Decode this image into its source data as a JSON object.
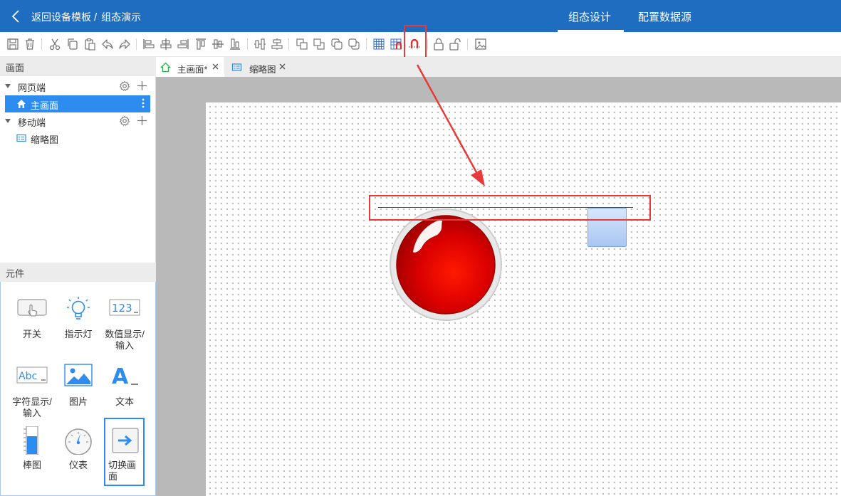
{
  "header": {
    "back_label": "返回设备模板",
    "separator": "/",
    "project_name": "组态演示",
    "tabs": [
      {
        "label": "组态设计",
        "active": true
      },
      {
        "label": "配置数据源",
        "active": false
      }
    ]
  },
  "toolbar": {
    "buttons": [
      {
        "name": "save-icon"
      },
      {
        "name": "delete-icon"
      },
      {
        "name": "cut-icon"
      },
      {
        "name": "copy-icon"
      },
      {
        "name": "paste-icon"
      },
      {
        "name": "undo-icon"
      },
      {
        "name": "redo-icon"
      },
      {
        "name": "align-left-icon"
      },
      {
        "name": "align-center-h-icon"
      },
      {
        "name": "align-right-icon"
      },
      {
        "name": "align-top-icon"
      },
      {
        "name": "align-middle-v-icon"
      },
      {
        "name": "align-bottom-icon"
      },
      {
        "name": "distribute-h-icon"
      },
      {
        "name": "distribute-v-icon"
      },
      {
        "name": "bring-front-icon"
      },
      {
        "name": "send-back-icon"
      },
      {
        "name": "bring-forward-icon"
      },
      {
        "name": "send-backward-icon"
      },
      {
        "name": "grid-icon"
      },
      {
        "name": "snap-grid-icon"
      },
      {
        "name": "snap-guide-icon"
      },
      {
        "name": "lock-icon"
      },
      {
        "name": "unlock-icon"
      },
      {
        "name": "image-icon"
      }
    ]
  },
  "left_panel": {
    "screens_title": "画面",
    "tree": {
      "web": {
        "label": "网页端",
        "pages": [
          {
            "label": "主画面",
            "selected": true
          }
        ]
      },
      "mobile": {
        "label": "移动端",
        "pages": [
          {
            "label": "缩略图",
            "selected": false
          }
        ]
      }
    },
    "components_title": "元件",
    "components": [
      {
        "label": "开关",
        "icon": "switch-icon"
      },
      {
        "label": "指示灯",
        "icon": "bulb-icon"
      },
      {
        "label": "数值显示/输入",
        "icon": "numeric-display-icon"
      },
      {
        "label": "字符显示/输入",
        "icon": "text-display-icon"
      },
      {
        "label": "图片",
        "icon": "picture-icon"
      },
      {
        "label": "文本",
        "icon": "text-icon"
      },
      {
        "label": "棒图",
        "icon": "bar-graph-icon"
      },
      {
        "label": "仪表",
        "icon": "gauge-icon"
      },
      {
        "label": "切换画面",
        "icon": "switch-screen-icon",
        "selected": true
      }
    ]
  },
  "editor_tabs": [
    {
      "label": "主画面*",
      "icon": "home-icon",
      "active": true
    },
    {
      "label": "缩略图",
      "icon": "thumbnail-icon",
      "active": false
    }
  ],
  "colors": {
    "header_bg": "#1f6dc0",
    "selection_blue": "#2d8cf0",
    "highlight_red": "#e8393b",
    "guide_line": "#3a3ad0",
    "lamp_red": "#d40000"
  }
}
